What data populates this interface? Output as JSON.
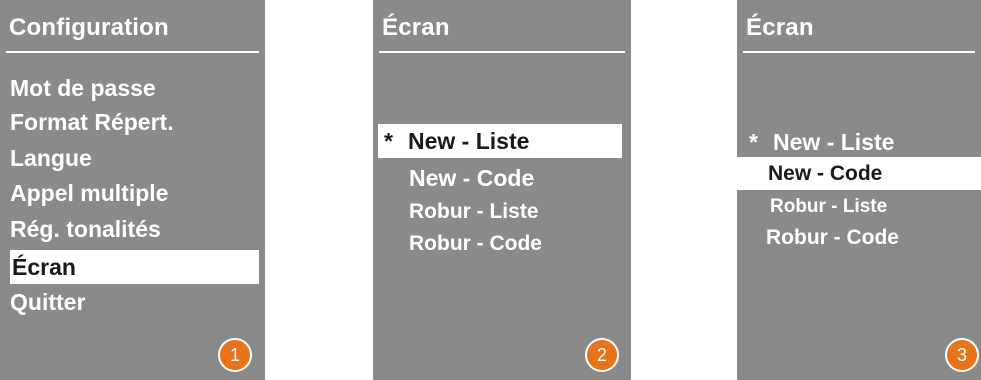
{
  "panels": [
    {
      "title": "Configuration",
      "items": [
        {
          "label": "Mot de passe",
          "star": "",
          "selected": false
        },
        {
          "label": "Format Répert.",
          "star": "",
          "selected": false
        },
        {
          "label": "Langue",
          "star": "",
          "selected": false
        },
        {
          "label": "Appel multiple",
          "star": "",
          "selected": false
        },
        {
          "label": "Rég. tonalités",
          "star": "",
          "selected": false
        },
        {
          "label": "Écran",
          "star": "",
          "selected": true
        },
        {
          "label": "Quitter",
          "star": "",
          "selected": false
        }
      ],
      "step": "1"
    },
    {
      "title": "Écran",
      "items": [
        {
          "label": "New - Liste",
          "star": "*",
          "selected": true
        },
        {
          "label": "New - Code",
          "star": "",
          "selected": false
        },
        {
          "label": "Robur - Liste",
          "star": "",
          "selected": false
        },
        {
          "label": "Robur - Code",
          "star": "",
          "selected": false
        }
      ],
      "step": "2"
    },
    {
      "title": "Écran",
      "items": [
        {
          "label": "New - Liste",
          "star": "*",
          "selected": false
        },
        {
          "label": "New - Code",
          "star": "",
          "selected": true
        },
        {
          "label": "Robur - Liste",
          "star": "",
          "selected": false
        },
        {
          "label": "Robur - Code",
          "star": "",
          "selected": false
        }
      ],
      "step": "3"
    }
  ],
  "colors": {
    "screen_background": "#8a8a8a",
    "text": "#ffffff",
    "highlight_background": "#ffffff",
    "highlight_text": "#1a1a1a",
    "badge": "#e8731a"
  }
}
